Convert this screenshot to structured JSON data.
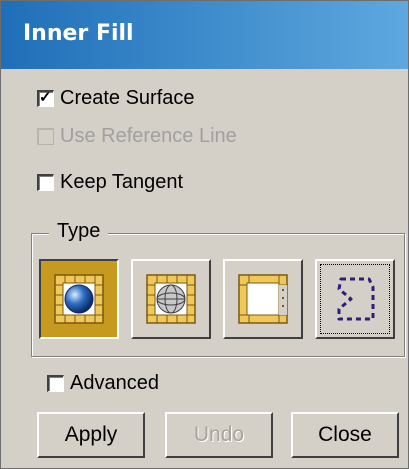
{
  "dialog": {
    "title": "Inner Fill"
  },
  "options": {
    "create_surface": {
      "label": "Create Surface",
      "checked": true,
      "enabled": true
    },
    "use_reference_line": {
      "label": "Use Reference Line",
      "checked": false,
      "enabled": false
    },
    "keep_tangent": {
      "label": "Keep Tangent",
      "checked": false,
      "enabled": true
    }
  },
  "type_group": {
    "label": "Type",
    "buttons": [
      {
        "icon": "grid-filled-sphere-icon",
        "selected": true
      },
      {
        "icon": "grid-wire-sphere-icon",
        "selected": false
      },
      {
        "icon": "grid-open-boundary-icon",
        "selected": false
      },
      {
        "icon": "dashed-boundary-icon",
        "selected": false,
        "focused": true
      }
    ]
  },
  "advanced": {
    "label": "Advanced",
    "checked": false
  },
  "buttons": {
    "apply": "Apply",
    "undo": "Undo",
    "close": "Close"
  },
  "colors": {
    "title_bar_start": "#1f6fb8",
    "title_bar_end": "#5ea8df",
    "selected_button": "#c59a1e",
    "grid_fill": "#f2c75a",
    "face": "#d4d0c8"
  }
}
